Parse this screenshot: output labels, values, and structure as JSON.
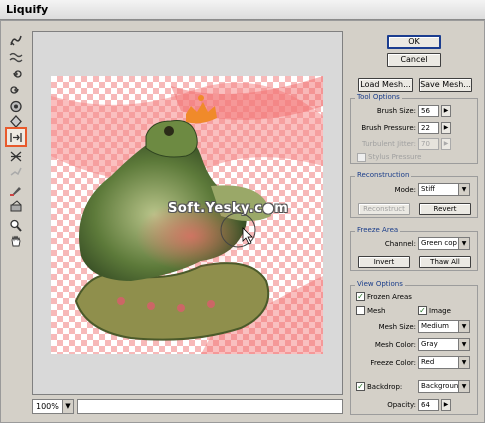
{
  "window": {
    "title": "Liquify"
  },
  "tools": [
    "warp-tool",
    "turbulence-tool",
    "twirl-clockwise-tool",
    "twirl-counterclockwise-tool",
    "pucker-tool",
    "bloat-tool",
    "shift-pixels-tool",
    "reflection-tool",
    "reconstruct-tool",
    "freeze-mask-tool",
    "thaw-mask-tool",
    "zoom-tool",
    "hand-tool"
  ],
  "selected_tool": "shift-pixels-tool",
  "canvas": {
    "watermark": "Soft.Yesky.c●m",
    "zoom": "100%"
  },
  "buttons": {
    "ok": "OK",
    "cancel": "Cancel",
    "load_mesh": "Load Mesh...",
    "save_mesh": "Save Mesh..."
  },
  "tool_options": {
    "title": "Tool Options",
    "brush_size_label": "Brush Size:",
    "brush_size": "56",
    "brush_pressure_label": "Brush Pressure:",
    "brush_pressure": "22",
    "turbulent_jitter_label": "Turbulent Jitter:",
    "turbulent_jitter": "70",
    "stylus_pressure_label": "Stylus Pressure"
  },
  "reconstruction": {
    "title": "Reconstruction",
    "mode_label": "Mode:",
    "mode": "Stiff",
    "reconstruct": "Reconstruct",
    "revert": "Revert"
  },
  "freeze_area": {
    "title": "Freeze Area",
    "channel_label": "Channel:",
    "channel": "Green cop",
    "invert": "Invert",
    "thaw_all": "Thaw All"
  },
  "view_options": {
    "title": "View Options",
    "frozen_areas": "Frozen Areas",
    "mesh": "Mesh",
    "image": "Image",
    "mesh_size_label": "Mesh Size:",
    "mesh_size": "Medium",
    "mesh_color_label": "Mesh Color:",
    "mesh_color": "Gray",
    "freeze_color_label": "Freeze Color:",
    "freeze_color": "Red",
    "backdrop": "Backdrop:",
    "backdrop_value": "Backgroun",
    "opacity_label": "Opacity:",
    "opacity": "64"
  },
  "colors": {
    "selected_tool_border": "#e85a2c",
    "default_button_border": "#1b3d8f",
    "group_title": "#1a3d8a",
    "mask_pink": "#f7b9b9"
  }
}
